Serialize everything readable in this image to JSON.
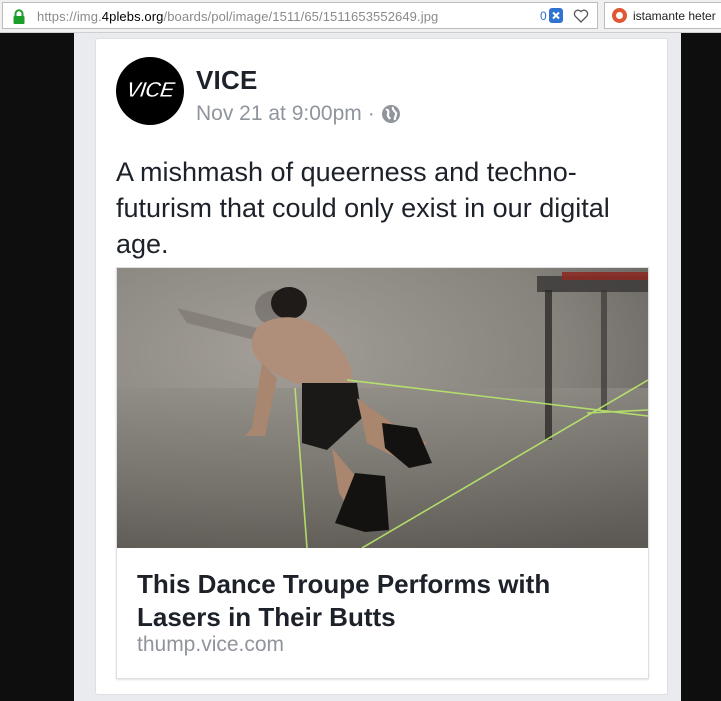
{
  "browser": {
    "url_prefix": "https://img.",
    "url_host": "4plebs.org",
    "url_path": "/boards/pol/image/1511/65/1511653552649.jpg",
    "badge_count": "0",
    "search_text": "istamante heter"
  },
  "post": {
    "avatar_text": "VICE",
    "page_name": "VICE",
    "timestamp": "Nov 21 at 9:00pm",
    "separator": "·",
    "body": "A mishmash of queerness and techno-futurism that could only exist in our digital age."
  },
  "link_preview": {
    "title": "This Dance Troupe Performs with Lasers in Their Butts",
    "domain": "thump.vice.com"
  },
  "colors": {
    "link_text": "#1d2129",
    "meta_text": "#90949c",
    "laser": "#b9e86a"
  }
}
